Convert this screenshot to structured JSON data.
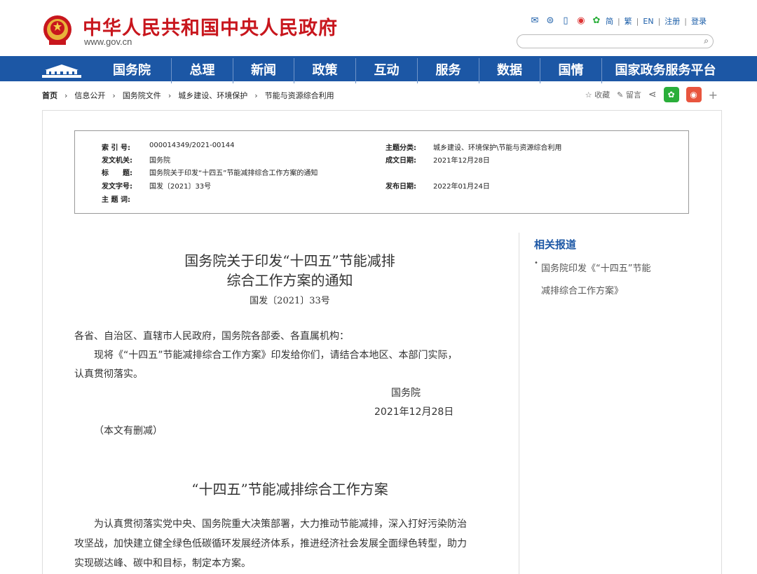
{
  "header": {
    "site_title": "中华人民共和国中央人民政府",
    "site_url": "www.gov.cn",
    "lang_links": [
      "简",
      "繁",
      "EN",
      "注册",
      "登录"
    ],
    "icons": [
      "mail-icon",
      "message-icon",
      "mobile-icon",
      "weibo-icon",
      "wechat-icon"
    ]
  },
  "nav": {
    "items": [
      "国务院",
      "总理",
      "新闻",
      "政策",
      "互动",
      "服务",
      "数据",
      "国情",
      "国家政务服务平台"
    ]
  },
  "breadcrumb": {
    "items": [
      "首页",
      "信息公开",
      "国务院文件",
      "城乡建设、环境保护",
      "节能与资源综合利用"
    ]
  },
  "tools": {
    "favorite": "收藏",
    "comment": "留言",
    "plus": "+"
  },
  "info": {
    "index_no_label": "索 引 号:",
    "index_no": "000014349/2021-00144",
    "issuer_label": "发文机关:",
    "issuer": "国务院",
    "title_label": "标　　题:",
    "title": "国务院关于印发“十四五”节能减排综合工作方案的通知",
    "doc_no_label": "发文字号:",
    "doc_no": "国发〔2021〕33号",
    "keywords_label": "主 题 词:",
    "topic_label": "主题分类:",
    "topic": "城乡建设、环境保护\\节能与资源综合利用",
    "created_label": "成文日期:",
    "created": "2021年12月28日",
    "published_label": "发布日期:",
    "published": "2022年01月24日"
  },
  "article": {
    "title_line1": "国务院关于印发“十四五”节能减排",
    "title_line2": "综合工作方案的通知",
    "doc_no": "国发〔2021〕33号",
    "addressee": "各省、自治区、直辖市人民政府，国务院各部委、各直属机构：",
    "body": "现将《“十四五”节能减排综合工作方案》印发给你们，请结合本地区、本部门实际，",
    "body_cont": "认真贯彻落实。",
    "signer": "国务院",
    "date": "2021年12月28日",
    "note": "（本文有删减）",
    "sub_title": "“十四五”节能减排综合工作方案",
    "p1_line1": "为认真贯彻落实党中央、国务院重大决策部署，大力推动节能减排，深入打好污染防治",
    "p1_line2": "攻坚战，加快建立健全绿色低碳循环发展经济体系，推进经济社会发展全面绿色转型，助力",
    "p1_line3": "实现碳达峰、碳中和目标，制定本方案。"
  },
  "sidebar": {
    "title": "相关报道",
    "item_line1": "国务院印发《“十四五”节能",
    "item_line2": "减排综合工作方案》"
  },
  "colors": {
    "brand_red": "#c8161d",
    "nav_blue": "#1c57a5",
    "link_blue": "#1a5da8"
  }
}
